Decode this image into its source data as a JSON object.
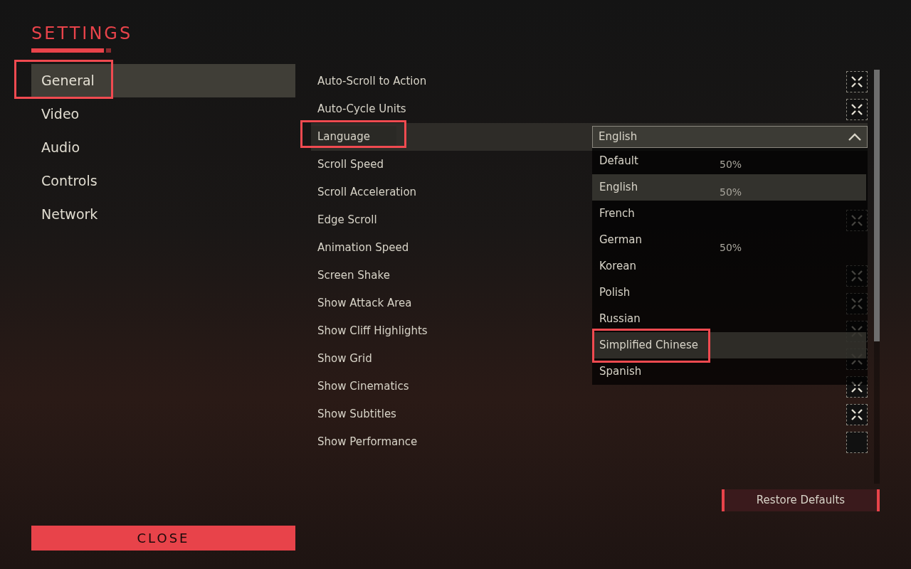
{
  "title": "SETTINGS",
  "sidebar": {
    "items": [
      {
        "label": "General",
        "selected": true,
        "annotated": true
      },
      {
        "label": "Video",
        "selected": false,
        "annotated": false
      },
      {
        "label": "Audio",
        "selected": false,
        "annotated": false
      },
      {
        "label": "Controls",
        "selected": false,
        "annotated": false
      },
      {
        "label": "Network",
        "selected": false,
        "annotated": false
      }
    ]
  },
  "rows": [
    {
      "kind": "toggle",
      "label": "Auto-Scroll to Action",
      "checked": true
    },
    {
      "kind": "toggle",
      "label": "Auto-Cycle Units",
      "checked": true
    },
    {
      "kind": "select",
      "label": "Language",
      "annotated": true,
      "value": "English",
      "expanded": true,
      "options": [
        {
          "label": "Default",
          "selected": false,
          "hovered": false,
          "annotated": false
        },
        {
          "label": "English",
          "selected": true,
          "hovered": false,
          "annotated": false
        },
        {
          "label": "French",
          "selected": false,
          "hovered": false,
          "annotated": false
        },
        {
          "label": "German",
          "selected": false,
          "hovered": false,
          "annotated": false
        },
        {
          "label": "Korean",
          "selected": false,
          "hovered": false,
          "annotated": false
        },
        {
          "label": "Polish",
          "selected": false,
          "hovered": false,
          "annotated": false
        },
        {
          "label": "Russian",
          "selected": false,
          "hovered": false,
          "annotated": false
        },
        {
          "label": "Simplified Chinese",
          "selected": false,
          "hovered": true,
          "annotated": true
        },
        {
          "label": "Spanish",
          "selected": false,
          "hovered": false,
          "annotated": false
        }
      ]
    },
    {
      "kind": "value",
      "label": "Scroll Speed",
      "value": "50%"
    },
    {
      "kind": "value",
      "label": "Scroll Acceleration",
      "value": "50%"
    },
    {
      "kind": "toggle",
      "label": "Edge Scroll",
      "checked": true
    },
    {
      "kind": "value",
      "label": "Animation Speed",
      "value": "50%"
    },
    {
      "kind": "toggle",
      "label": "Screen Shake",
      "checked": true
    },
    {
      "kind": "toggle",
      "label": "Show Attack Area",
      "checked": true
    },
    {
      "kind": "toggle",
      "label": "Show Cliff Highlights",
      "checked": true
    },
    {
      "kind": "toggle",
      "label": "Show Grid",
      "checked": true
    },
    {
      "kind": "toggle",
      "label": "Show Cinematics",
      "checked": true
    },
    {
      "kind": "toggle",
      "label": "Show Subtitles",
      "checked": true
    },
    {
      "kind": "toggle",
      "label": "Show Performance",
      "checked": false
    }
  ],
  "restore_button": "Restore Defaults",
  "close_button": "CLOSE"
}
